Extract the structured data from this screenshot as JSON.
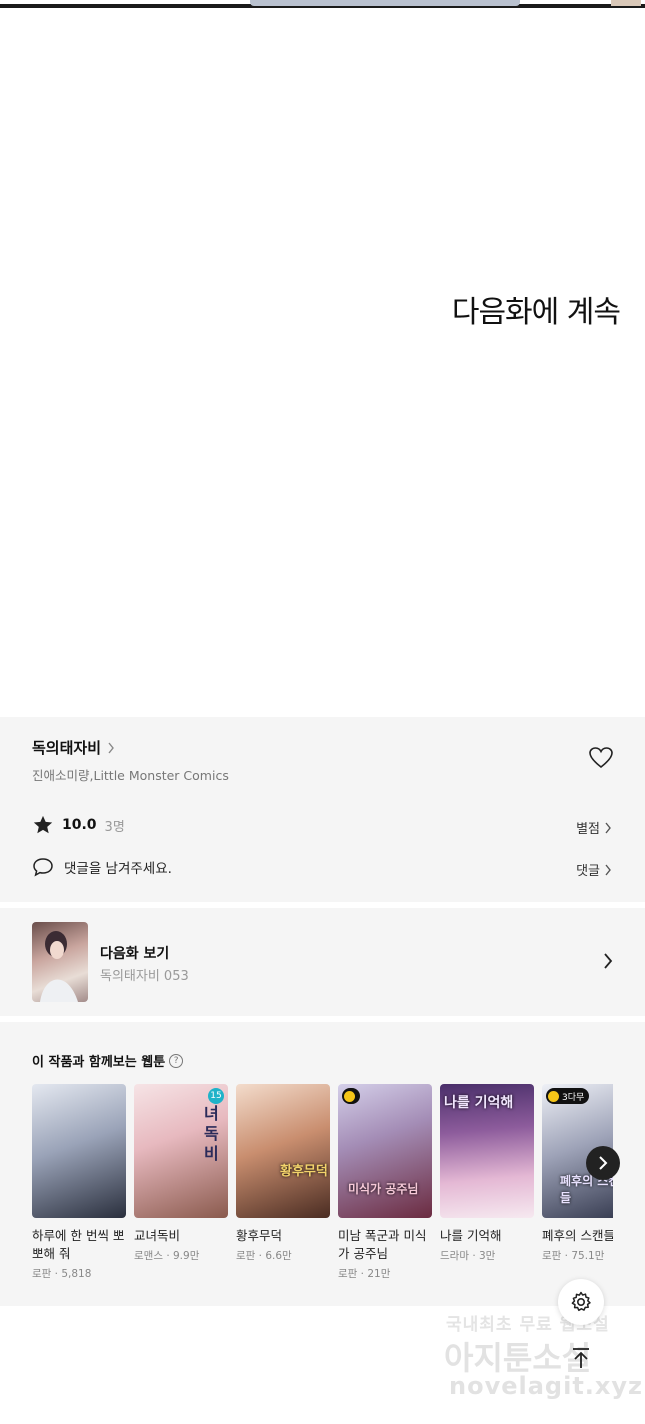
{
  "viewer": {
    "continue_text": "다음화에 계속"
  },
  "series": {
    "title": "독의태자비",
    "authors": "진애소미량,Little Monster Comics",
    "rating": "10.0",
    "rating_count": "3명",
    "rate_link": "별점",
    "comment_placeholder": "댓글을 남겨주세요.",
    "comment_link": "댓글"
  },
  "next_episode": {
    "label": "다음화 보기",
    "subtitle": "독의태자비 053"
  },
  "recommendations": {
    "title": "이 작품과 함께보는 웹툰",
    "help": "?",
    "items": [
      {
        "name": "하루에 한 번씩 뽀뽀해 줘",
        "meta": "로판 · 5,818",
        "cover_text": "",
        "colors": [
          "#d6dbe6",
          "#2a2f3d"
        ]
      },
      {
        "name": "교녀독비",
        "meta": "로맨스 · 9.9만",
        "cover_text": "녀독비",
        "badge_num": "15",
        "colors": [
          "#f2d8dc",
          "#8a5a4d"
        ]
      },
      {
        "name": "황후무덕",
        "meta": "로판 · 6.6만",
        "cover_text": "황후무덕",
        "colors": [
          "#e9c9b6",
          "#6b3f2f"
        ]
      },
      {
        "name": "미남 폭군과 미식가 공주님",
        "meta": "로판 · 21만",
        "cover_text": "미식가 공주님",
        "colors": [
          "#b9b3d6",
          "#6b2b40"
        ]
      },
      {
        "name": "나를 기억해",
        "meta": "드라마 · 3만",
        "cover_text": "나를 기억해",
        "colors": [
          "#5a3c7a",
          "#e4b8d4"
        ]
      },
      {
        "name": "폐후의 스캔들",
        "meta": "로판 · 75.1만",
        "cover_text": "폐후의 스캔들",
        "badge_text": "3다무",
        "colors": [
          "#d8d9e3",
          "#30354a"
        ]
      }
    ]
  },
  "watermark": {
    "line1": "국내최초 무료 웹소설",
    "line2": "아지툰소설",
    "line3": "novelagit.xyz"
  },
  "icons": [
    "heart-icon",
    "star-icon",
    "speech-bubble-icon",
    "chevron-right-icon",
    "gear-icon",
    "arrow-up-icon",
    "clock-icon"
  ]
}
